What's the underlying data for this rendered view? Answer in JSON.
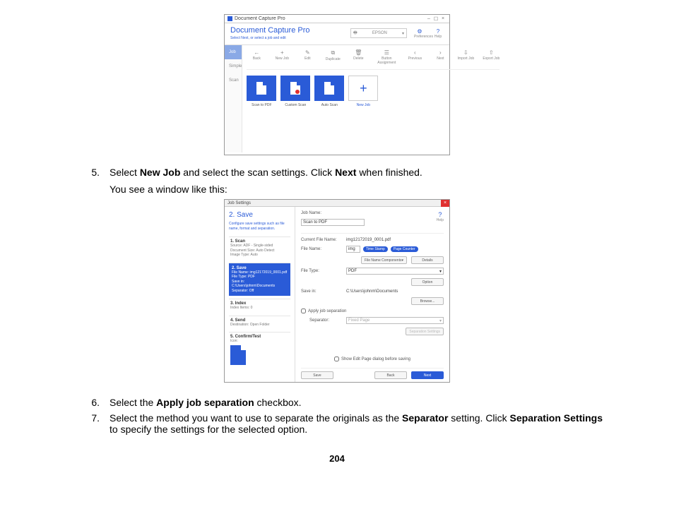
{
  "page_number": "204",
  "shot1": {
    "window_title": "Document Capture Pro",
    "app_title": "Document Capture Pro",
    "subtitle": "Select Next, or select a job and edit",
    "scanner": "EPSON",
    "preferences": "Preferences",
    "help": "Help",
    "side": [
      "Job Scan",
      "Simple Scan"
    ],
    "tools": [
      "Back",
      "New Job",
      "Edit",
      "Duplicate",
      "Delete",
      "Button Assignment",
      "Previous",
      "Next",
      "Import Job",
      "Export Job"
    ],
    "tiles": [
      "Scan to PDF",
      "Custom Scan",
      "Auto Scan",
      "New Job"
    ]
  },
  "steps": [
    {
      "num": "5.",
      "t1": "Select",
      "b1": "New Job",
      "t2": "and select the scan settings. Click",
      "b2": "Next",
      "t3": "when finished.",
      "sub": "You see a window like this:"
    },
    {
      "num": "6.",
      "t1": "Select the",
      "b1": "Apply job separation",
      "t2": "checkbox."
    },
    {
      "num": "7.",
      "t1": "Select the method you want to use to separate the originals as the",
      "b1": "Separator",
      "t2": "setting. Click",
      "b2": "Separation Settings",
      "t3": "to specify the settings for the selected option."
    }
  ],
  "shot2": {
    "title": "Job Settings",
    "help": "Help",
    "left": {
      "heading": "2. Save",
      "sub": "Configure save settings such as file name, format and separation.",
      "scan": {
        "hd": "1. Scan",
        "l1": "Source: ADF - Single-sided",
        "l2": "Document Size: Auto Detect",
        "l3": "Image Type: Auto"
      },
      "save": {
        "hd": "2. Save",
        "l1": "File Name: img12172019_0001.pdf",
        "l2": "File Type: PDF",
        "l3": "Save in: C:\\Users\\johnm\\Documents",
        "l4": "Separator: Off"
      },
      "index": {
        "hd": "3. Index",
        "l1": "Index Items: 0"
      },
      "send": {
        "hd": "4. Send",
        "l1": "Destination: Open Folder"
      },
      "confirm": {
        "hd": "5. Confirm/Test",
        "l1": "Icon:"
      }
    },
    "fields": {
      "jobname": {
        "lbl": "Job Name:",
        "val": "Scan to PDF"
      },
      "cfn": {
        "lbl": "Current File Name:",
        "val": "img12172019_0001.pdf"
      },
      "fname": {
        "lbl": "File Name:",
        "prefix": "img",
        "pill1": "Time Stamp",
        "pill2": "Page Counter"
      },
      "ftype": {
        "lbl": "File Type:",
        "val": "PDF"
      },
      "savein": {
        "lbl": "Save in:",
        "val": "C:\\Users\\johnm\\Documents"
      },
      "sep": {
        "chk": "Apply job separation",
        "lbl": "Separator:",
        "val": "Fixed Page"
      },
      "editpage": "Show Edit Page dialog before saving"
    },
    "buttons": {
      "components": "File Name Components",
      "details": "Details",
      "option": "Option",
      "browse": "Browse...",
      "sepset": "Separation Settings",
      "save": "Save",
      "back": "Back",
      "next": "Next"
    }
  }
}
